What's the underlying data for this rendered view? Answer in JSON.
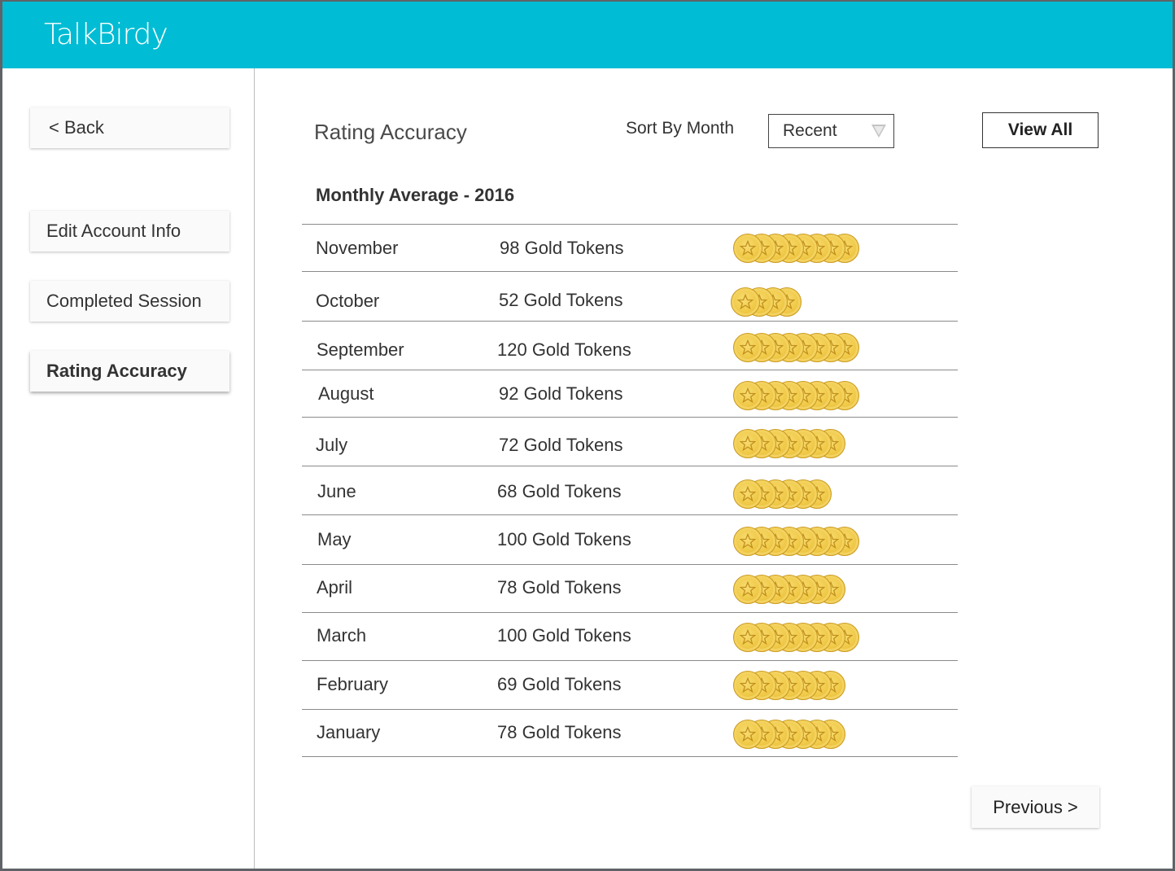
{
  "app": {
    "logo_text": "TalkBirdy"
  },
  "sidebar": {
    "back_label": "< Back",
    "items": [
      {
        "label": "Edit Account Info",
        "active": false
      },
      {
        "label": "Completed Session",
        "active": false
      },
      {
        "label": "Rating Accuracy",
        "active": true
      }
    ]
  },
  "main": {
    "title": "Rating Accuracy",
    "sort_label": "Sort By Month",
    "sort_select": {
      "value": "Recent"
    },
    "view_all_label": "View All",
    "section_title": "Monthly Average - 2016",
    "previous_label": "Previous >"
  },
  "rows": [
    {
      "month": "November",
      "tokens": "98 Gold Tokens",
      "coins": 8
    },
    {
      "month": "October",
      "tokens": "52 Gold Tokens",
      "coins": 4
    },
    {
      "month": "September",
      "tokens": "120 Gold Tokens",
      "coins": 8
    },
    {
      "month": "August",
      "tokens": "92 Gold Tokens",
      "coins": 8
    },
    {
      "month": "July",
      "tokens": "72 Gold Tokens",
      "coins": 7
    },
    {
      "month": "June",
      "tokens": "68 Gold Tokens",
      "coins": 6
    },
    {
      "month": "May",
      "tokens": "100 Gold Tokens",
      "coins": 8
    },
    {
      "month": "April",
      "tokens": "78 Gold Tokens",
      "coins": 7
    },
    {
      "month": "March",
      "tokens": "100 Gold Tokens",
      "coins": 8
    },
    {
      "month": "February",
      "tokens": "69 Gold Tokens",
      "coins": 7
    },
    {
      "month": "January",
      "tokens": "78 Gold Tokens",
      "coins": 7
    }
  ],
  "colors": {
    "header": "#00bcd4",
    "coin": "#f0c947"
  },
  "icons": {
    "coin": "gold-coin-star-icon",
    "dropdown": "triangle-down-icon"
  }
}
